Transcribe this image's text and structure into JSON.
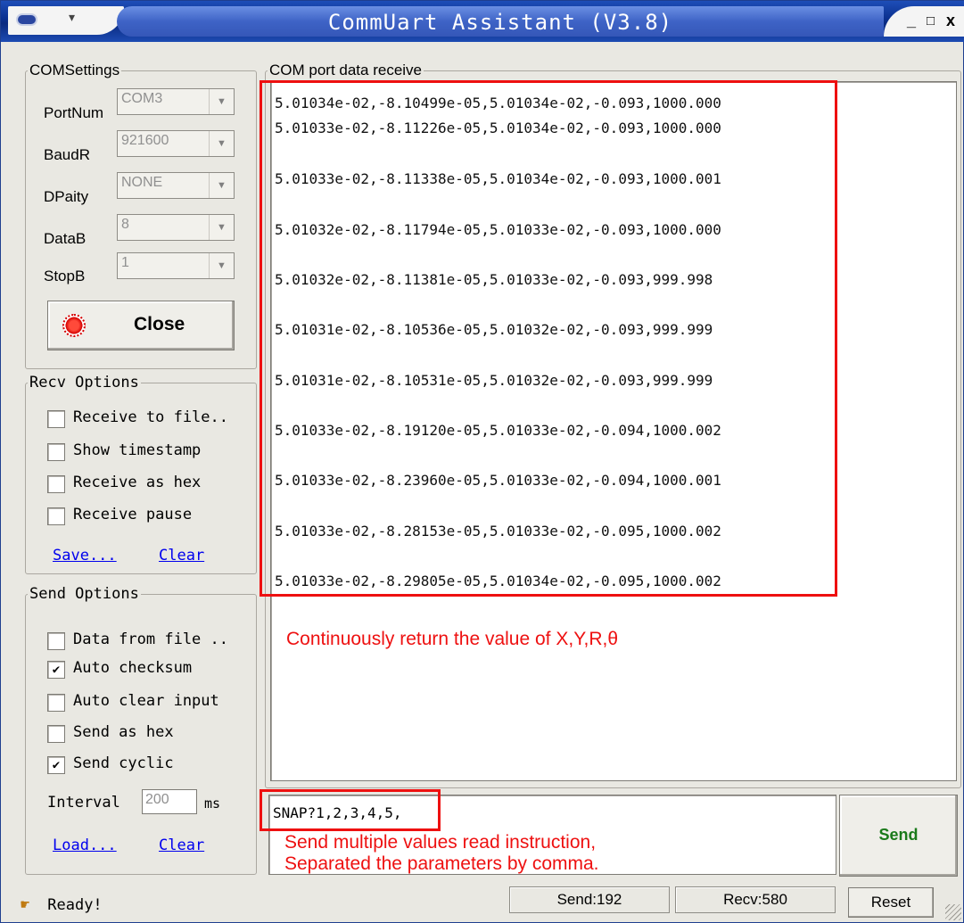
{
  "window": {
    "title": "CommUart Assistant (V3.8)",
    "controls": {
      "minimize": "_",
      "maximize": "□",
      "close": "x"
    }
  },
  "com_settings": {
    "legend": "COMSettings",
    "port_label": "PortNum",
    "port_value": "COM3",
    "baud_label": "BaudR",
    "baud_value": "921600",
    "parity_label": "DPaity",
    "parity_value": "NONE",
    "databits_label": "DataB",
    "databits_value": "8",
    "stopbits_label": "StopB",
    "stopbits_value": "1",
    "close_button": "Close"
  },
  "recv_options": {
    "legend": "Recv Options",
    "items": [
      {
        "label": "Receive to file..",
        "checked": false
      },
      {
        "label": "Show timestamp",
        "checked": false
      },
      {
        "label": "Receive as hex",
        "checked": false
      },
      {
        "label": "Receive pause",
        "checked": false
      }
    ],
    "save_link": "Save...",
    "clear_link": "Clear"
  },
  "send_options": {
    "legend": "Send Options",
    "items": [
      {
        "label": "Data from file ..",
        "checked": false
      },
      {
        "label": "Auto checksum",
        "checked": true
      },
      {
        "label": "Auto clear input",
        "checked": false
      },
      {
        "label": "Send as hex",
        "checked": false
      },
      {
        "label": "Send cyclic",
        "checked": true
      }
    ],
    "interval_label": "Interval",
    "interval_value": "200",
    "interval_unit": "ms",
    "load_link": "Load...",
    "clear_link": "Clear"
  },
  "receive": {
    "legend": "COM port data receive",
    "lines": [
      "5.01034e-02,-8.10499e-05,5.01034e-02,-0.093,1000.000",
      "5.01033e-02,-8.11226e-05,5.01034e-02,-0.093,1000.000",
      "5.01033e-02,-8.11338e-05,5.01034e-02,-0.093,1000.001",
      "5.01032e-02,-8.11794e-05,5.01033e-02,-0.093,1000.000",
      "5.01032e-02,-8.11381e-05,5.01033e-02,-0.093,999.998",
      "5.01031e-02,-8.10536e-05,5.01032e-02,-0.093,999.999",
      "5.01031e-02,-8.10531e-05,5.01032e-02,-0.093,999.999",
      "5.01033e-02,-8.19120e-05,5.01033e-02,-0.094,1000.002",
      "5.01033e-02,-8.23960e-05,5.01033e-02,-0.094,1000.001",
      "5.01033e-02,-8.28153e-05,5.01033e-02,-0.095,1000.002",
      "5.01033e-02,-8.29805e-05,5.01034e-02,-0.095,1000.002"
    ]
  },
  "annotations": {
    "receive_note": "Continuously return the value of X,Y,R,θ",
    "send_note_1": "Send multiple values read instruction,",
    "send_note_2": "Separated the parameters by comma."
  },
  "send": {
    "input_value": "SNAP?1,2,3,4,5,",
    "button": "Send"
  },
  "status": {
    "ready": "Ready!",
    "send_count": "Send:192",
    "recv_count": "Recv:580",
    "reset_button": "Reset"
  },
  "colors": {
    "titlebar": "#0a2f8d",
    "annotation": "#ee1010",
    "send_button_text": "#1a7a1a"
  }
}
